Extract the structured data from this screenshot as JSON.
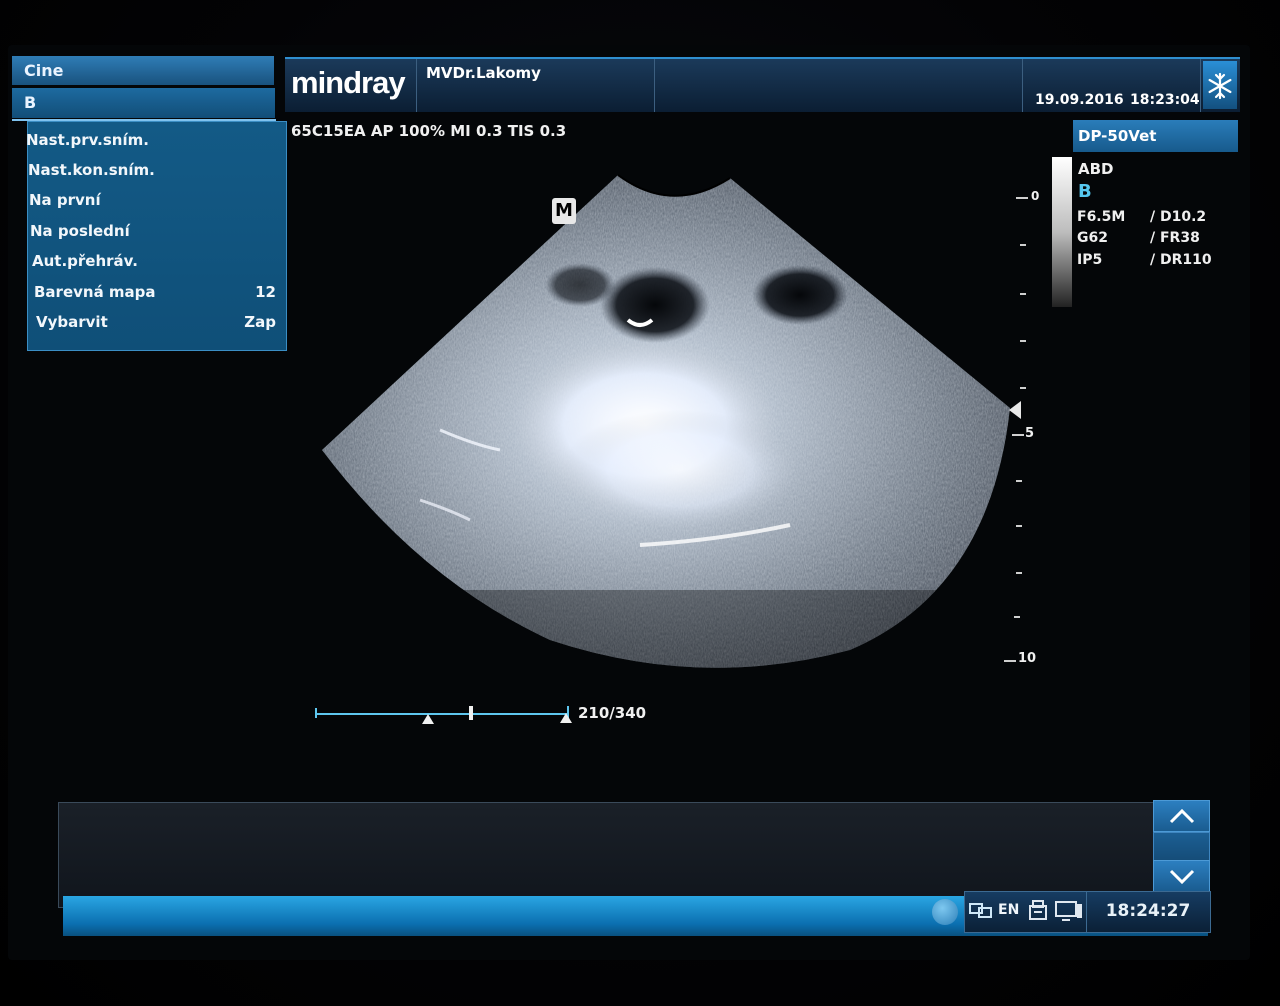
{
  "left_panel": {
    "title": "Cine",
    "mode": "B",
    "items": [
      {
        "label": "Nast.prv.sním.",
        "value": ""
      },
      {
        "label": "Nast.kon.sním.",
        "value": ""
      },
      {
        "label": "Na první",
        "value": ""
      },
      {
        "label": "Na poslední",
        "value": ""
      },
      {
        "label": "Aut.přehráv.",
        "value": ""
      },
      {
        "label": "Barevná mapa",
        "value": "12"
      },
      {
        "label": "Vybarvit",
        "value": "Zap"
      }
    ]
  },
  "header": {
    "logo": "mindray",
    "operator": "MVDr.Lakomy",
    "date": "19.09.2016",
    "time": "18:23:04",
    "freeze_icon": "snowflake-icon"
  },
  "params": "65C15EA  AP 100%  MI 0.3 TIS 0.3",
  "right_panel": {
    "title": "DP-50Vet",
    "exam": "ABD",
    "mode": "B",
    "rows": [
      {
        "left": "F6.5M",
        "right": "/ D10.2"
      },
      {
        "left": "G62",
        "right": "/ FR38"
      },
      {
        "left": "IP5",
        "right": "/ DR110"
      }
    ]
  },
  "depth_scale": {
    "labels": [
      "0",
      "5",
      "10"
    ]
  },
  "marker": "M",
  "cine": {
    "frame_counter": "210/340",
    "current_frame": 210,
    "total_frames": 340
  },
  "taskbar": {
    "language": "EN",
    "clock": "18:24:27"
  },
  "colors": {
    "accent": "#2a7dba",
    "panel": "#135a86",
    "background": "#040608"
  }
}
